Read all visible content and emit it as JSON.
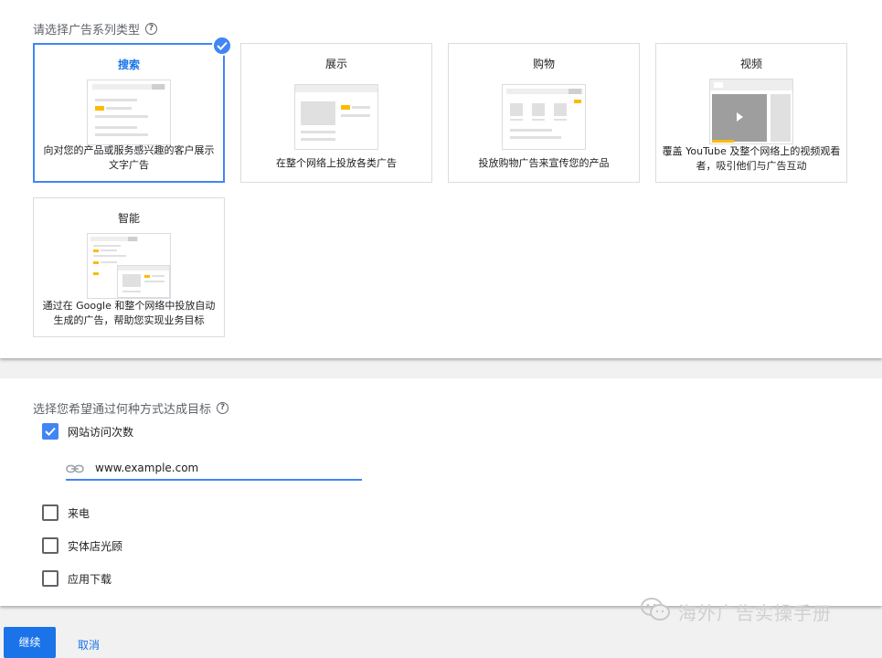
{
  "campaign_type": {
    "label": "请选择广告系列类型",
    "cards": [
      {
        "title": "搜索",
        "description": "向对您的产品或服务感兴趣的客户展示文字广告",
        "selected": true
      },
      {
        "title": "展示",
        "description": "在整个网络上投放各类广告",
        "selected": false
      },
      {
        "title": "购物",
        "description": "投放购物广告来宣传您的产品",
        "selected": false
      },
      {
        "title": "视频",
        "description": "覆盖 YouTube 及整个网络上的视频观看者，吸引他们与广告互动",
        "selected": false
      },
      {
        "title": "智能",
        "description": "通过在 Google 和整个网络中投放自动生成的广告，帮助您实现业务目标",
        "selected": false
      }
    ]
  },
  "goals": {
    "label": "选择您希望通过何种方式达成目标",
    "options": [
      {
        "label": "网站访问次数",
        "checked": true
      },
      {
        "label": "来电",
        "checked": false
      },
      {
        "label": "实体店光顾",
        "checked": false
      },
      {
        "label": "应用下载",
        "checked": false
      }
    ],
    "website_url": "www.example.com"
  },
  "actions": {
    "continue_label": "继续",
    "cancel_label": "取消"
  },
  "watermark": {
    "text": "海外广告实操手册"
  },
  "colors": {
    "accent": "#4285f4",
    "button": "#1a73e8",
    "highlight": "#fbbc04"
  }
}
